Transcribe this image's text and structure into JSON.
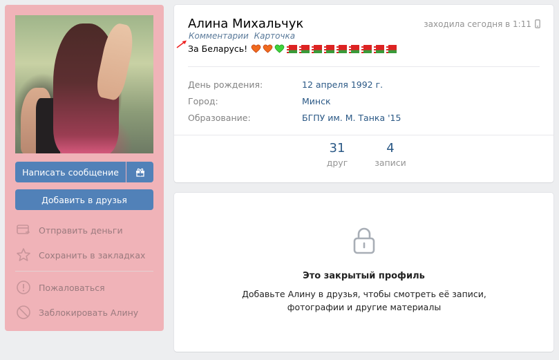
{
  "profile": {
    "name": "Алина Михальчук",
    "status_links": [
      "Комментарии",
      "Карточка"
    ],
    "status_text": "За Беларусь!",
    "online": "заходила сегодня в 1:11",
    "info": [
      {
        "label": "День рождения:",
        "value": "12 апреля 1992 г."
      },
      {
        "label": "Город:",
        "value": "Минск"
      },
      {
        "label": "Образование:",
        "value": "БГПУ им. М. Танка '15"
      }
    ],
    "counters": [
      {
        "num": "31",
        "label": "друг"
      },
      {
        "num": "4",
        "label": "записи"
      }
    ]
  },
  "actions": {
    "message_label": "Написать сообщение",
    "add_friend_label": "Добавить в друзья"
  },
  "menu": {
    "group1": [
      "Отправить деньги",
      "Сохранить в закладках"
    ],
    "group2": [
      "Пожаловаться",
      "Заблокировать Алину"
    ]
  },
  "closed": {
    "title": "Это закрытый профиль",
    "desc": "Добавьте Алину в друзья, чтобы смотреть её записи, фотографии и другие материалы"
  },
  "colors": {
    "accent": "#5181b8",
    "left_bg": "#f0b3b8",
    "link": "#2a5885"
  }
}
